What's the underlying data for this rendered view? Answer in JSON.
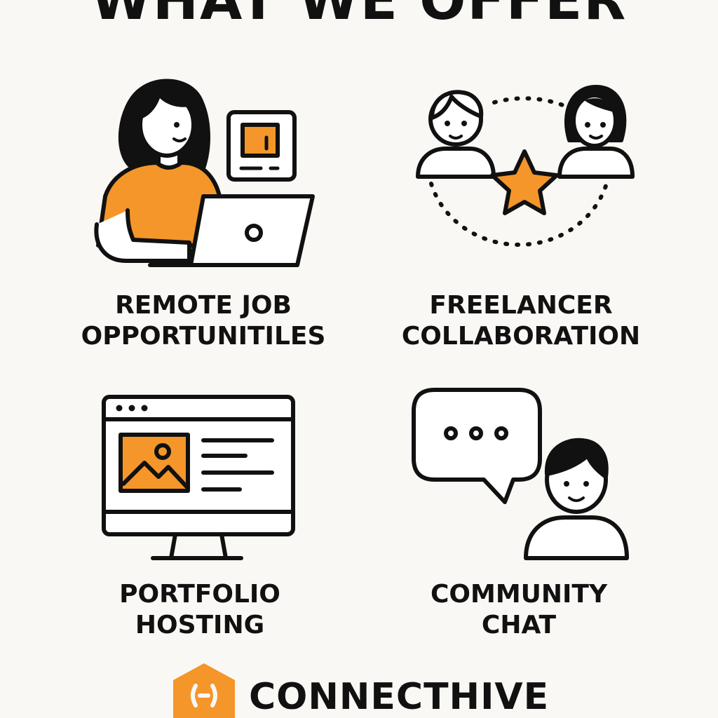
{
  "header": {
    "title": "WHAT WE OFFER"
  },
  "colors": {
    "accent": "#f5962a",
    "ink": "#111111",
    "background": "#faf8f4"
  },
  "offers": [
    {
      "icon": "remote-worker-laptop-icon",
      "line1": "REMOTE JOB",
      "line2": "OPPORTUNITILES"
    },
    {
      "icon": "people-collaboration-star-icon",
      "line1": "FREELANCER",
      "line2": "COLLABORATION"
    },
    {
      "icon": "monitor-portfolio-icon",
      "line1": "PORTFOLIO",
      "line2": "HOSTING"
    },
    {
      "icon": "chat-bubble-person-icon",
      "line1": "COMMUNITY",
      "line2": "CHAT"
    }
  ],
  "brand": {
    "name": "CONNECTHIVE",
    "logo_icon": "hexagon-logo-icon"
  }
}
